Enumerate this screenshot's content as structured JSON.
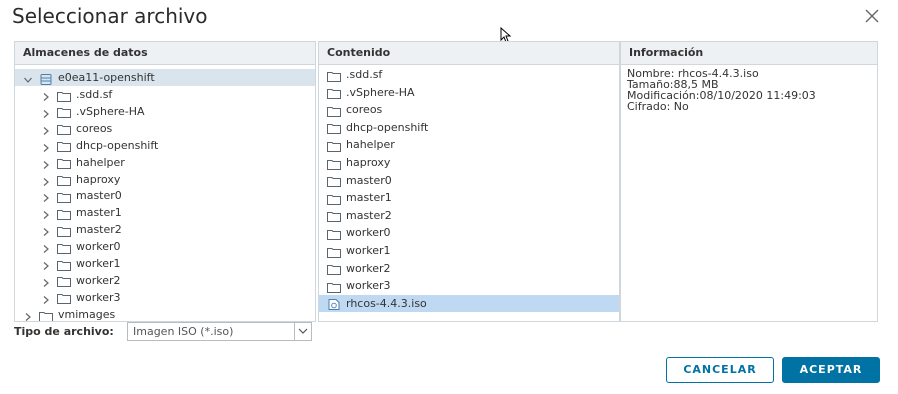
{
  "dialog": {
    "title": "Seleccionar archivo",
    "close_icon": "close-icon"
  },
  "datastores": {
    "header": "Almacenes de datos",
    "root": "e0ea11-openshift",
    "children": [
      ".sdd.sf",
      ".vSphere-HA",
      "coreos",
      "dhcp-openshift",
      "hahelper",
      "haproxy",
      "master0",
      "master1",
      "master2",
      "worker0",
      "worker1",
      "worker2",
      "worker3"
    ],
    "sibling": "vmimages"
  },
  "contents": {
    "header": "Contenido",
    "items": [
      ".sdd.sf",
      ".vSphere-HA",
      "coreos",
      "dhcp-openshift",
      "hahelper",
      "haproxy",
      "master0",
      "master1",
      "master2",
      "worker0",
      "worker1",
      "worker2",
      "worker3"
    ],
    "selected_file": "rhcos-4.4.3.iso"
  },
  "info": {
    "header": "Información",
    "lines": [
      "Nombre: rhcos-4.4.3.iso",
      "Tamaño:88,5 MB",
      "Modificación:08/10/2020 11:49:03",
      "Cifrado: No"
    ]
  },
  "filetype": {
    "label": "Tipo de archivo:",
    "selected": "Imagen ISO (*.iso)"
  },
  "buttons": {
    "cancel": "CANCELAR",
    "ok": "ACEPTAR"
  },
  "colors": {
    "accent": "#0072a3",
    "selection": "#bfd9f2",
    "tree_selection": "#d9e4ec",
    "header_bg": "#eef1f4"
  }
}
